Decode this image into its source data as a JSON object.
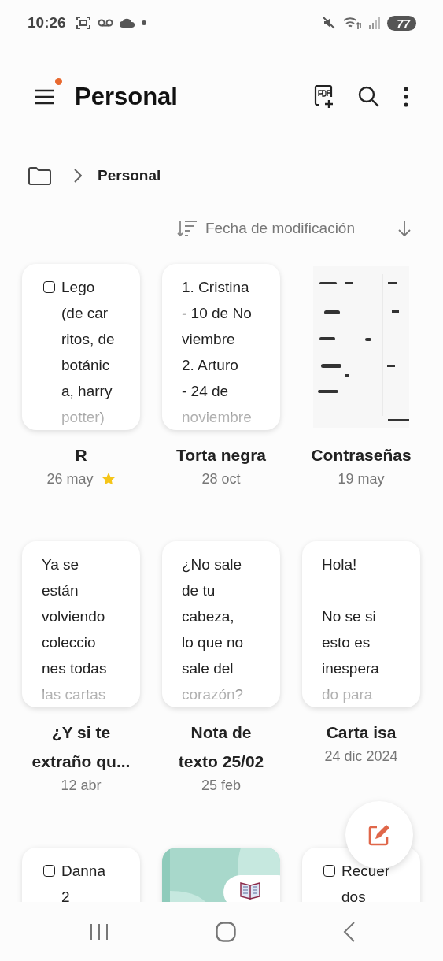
{
  "status_bar": {
    "time": "10:26",
    "battery": "77"
  },
  "header": {
    "title": "Personal",
    "menu_badge": true
  },
  "breadcrumb": {
    "items": [
      "Personal"
    ]
  },
  "sort": {
    "label": "Fecha de modificación"
  },
  "notes": [
    {
      "kind": "checklist",
      "checked": false,
      "lines": [
        "Lego",
        "(de car",
        "ritos, de",
        "botánic",
        "a, harry",
        "potter)"
      ],
      "title": [
        "R"
      ],
      "date": "26 may",
      "starred": true
    },
    {
      "kind": "text",
      "lines": [
        "1.  Cristina",
        "- 10 de No",
        "viembre",
        "2.  Arturo",
        "- 24 de",
        "noviembre"
      ],
      "title": [
        "Torta negra"
      ],
      "date": "28 oct",
      "starred": false
    },
    {
      "kind": "image",
      "title": [
        "Contraseñas"
      ],
      "date": "19 may",
      "starred": false
    },
    {
      "kind": "text",
      "lines": [
        "Ya se",
        "están",
        "volviendo",
        "coleccio",
        "nes todas",
        "las cartas"
      ],
      "title": [
        "¿Y si te",
        "extraño qu..."
      ],
      "date": "12 abr",
      "starred": false
    },
    {
      "kind": "text",
      "lines": [
        "¿No sale",
        "de tu",
        "cabeza,",
        "lo que no",
        "sale del",
        "corazón?"
      ],
      "title": [
        "Nota de",
        "texto 25/02"
      ],
      "date": "25 feb",
      "starred": false
    },
    {
      "kind": "text",
      "lines": [
        "Hola!"
      ],
      "more_lines": [
        "No se si",
        "esto es",
        "inespera",
        "do para"
      ],
      "title": [
        "Carta isa"
      ],
      "date": "24 dic 2024",
      "starred": false
    },
    {
      "kind": "checklist",
      "checked": false,
      "lines": [
        "Danna",
        "2"
      ]
    },
    {
      "kind": "cover"
    },
    {
      "kind": "checklist",
      "checked": false,
      "lines": [
        "Recuer",
        "dos"
      ]
    }
  ]
}
